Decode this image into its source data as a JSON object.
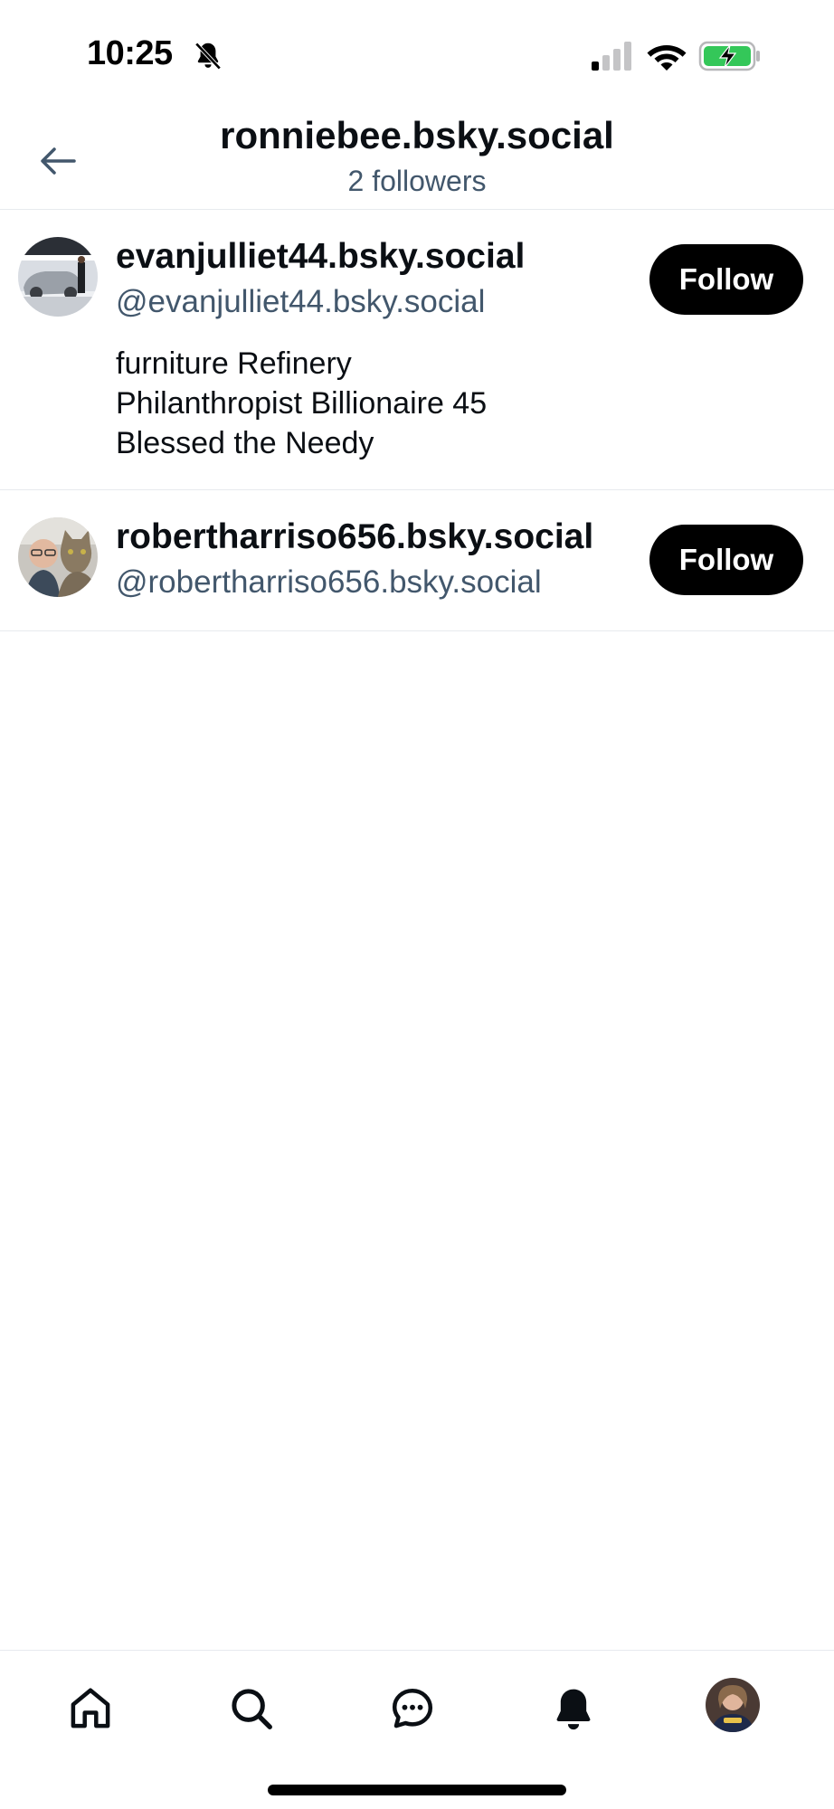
{
  "status_bar": {
    "time": "10:25"
  },
  "header": {
    "title": "ronniebee.bsky.social",
    "subtitle": "2 followers"
  },
  "followers": [
    {
      "display_name": "evanjulliet44.bsky.social",
      "handle": "@evanjulliet44.bsky.social",
      "bio_lines": [
        "furniture Refinery",
        "Philanthropist Billionaire 45",
        "Blessed the Needy"
      ],
      "follow_label": "Follow"
    },
    {
      "display_name": "robertharriso656.bsky.social",
      "handle": "@robertharriso656.bsky.social",
      "follow_label": "Follow"
    }
  ],
  "bottom_nav": {
    "items": [
      "home-icon",
      "search-icon",
      "chat-icon",
      "notifications-icon",
      "profile-avatar"
    ]
  },
  "colors": {
    "secondary_text": "#42576c",
    "divider": "#e7eaee",
    "follow_bg": "#000000",
    "battery_green": "#34c759"
  }
}
